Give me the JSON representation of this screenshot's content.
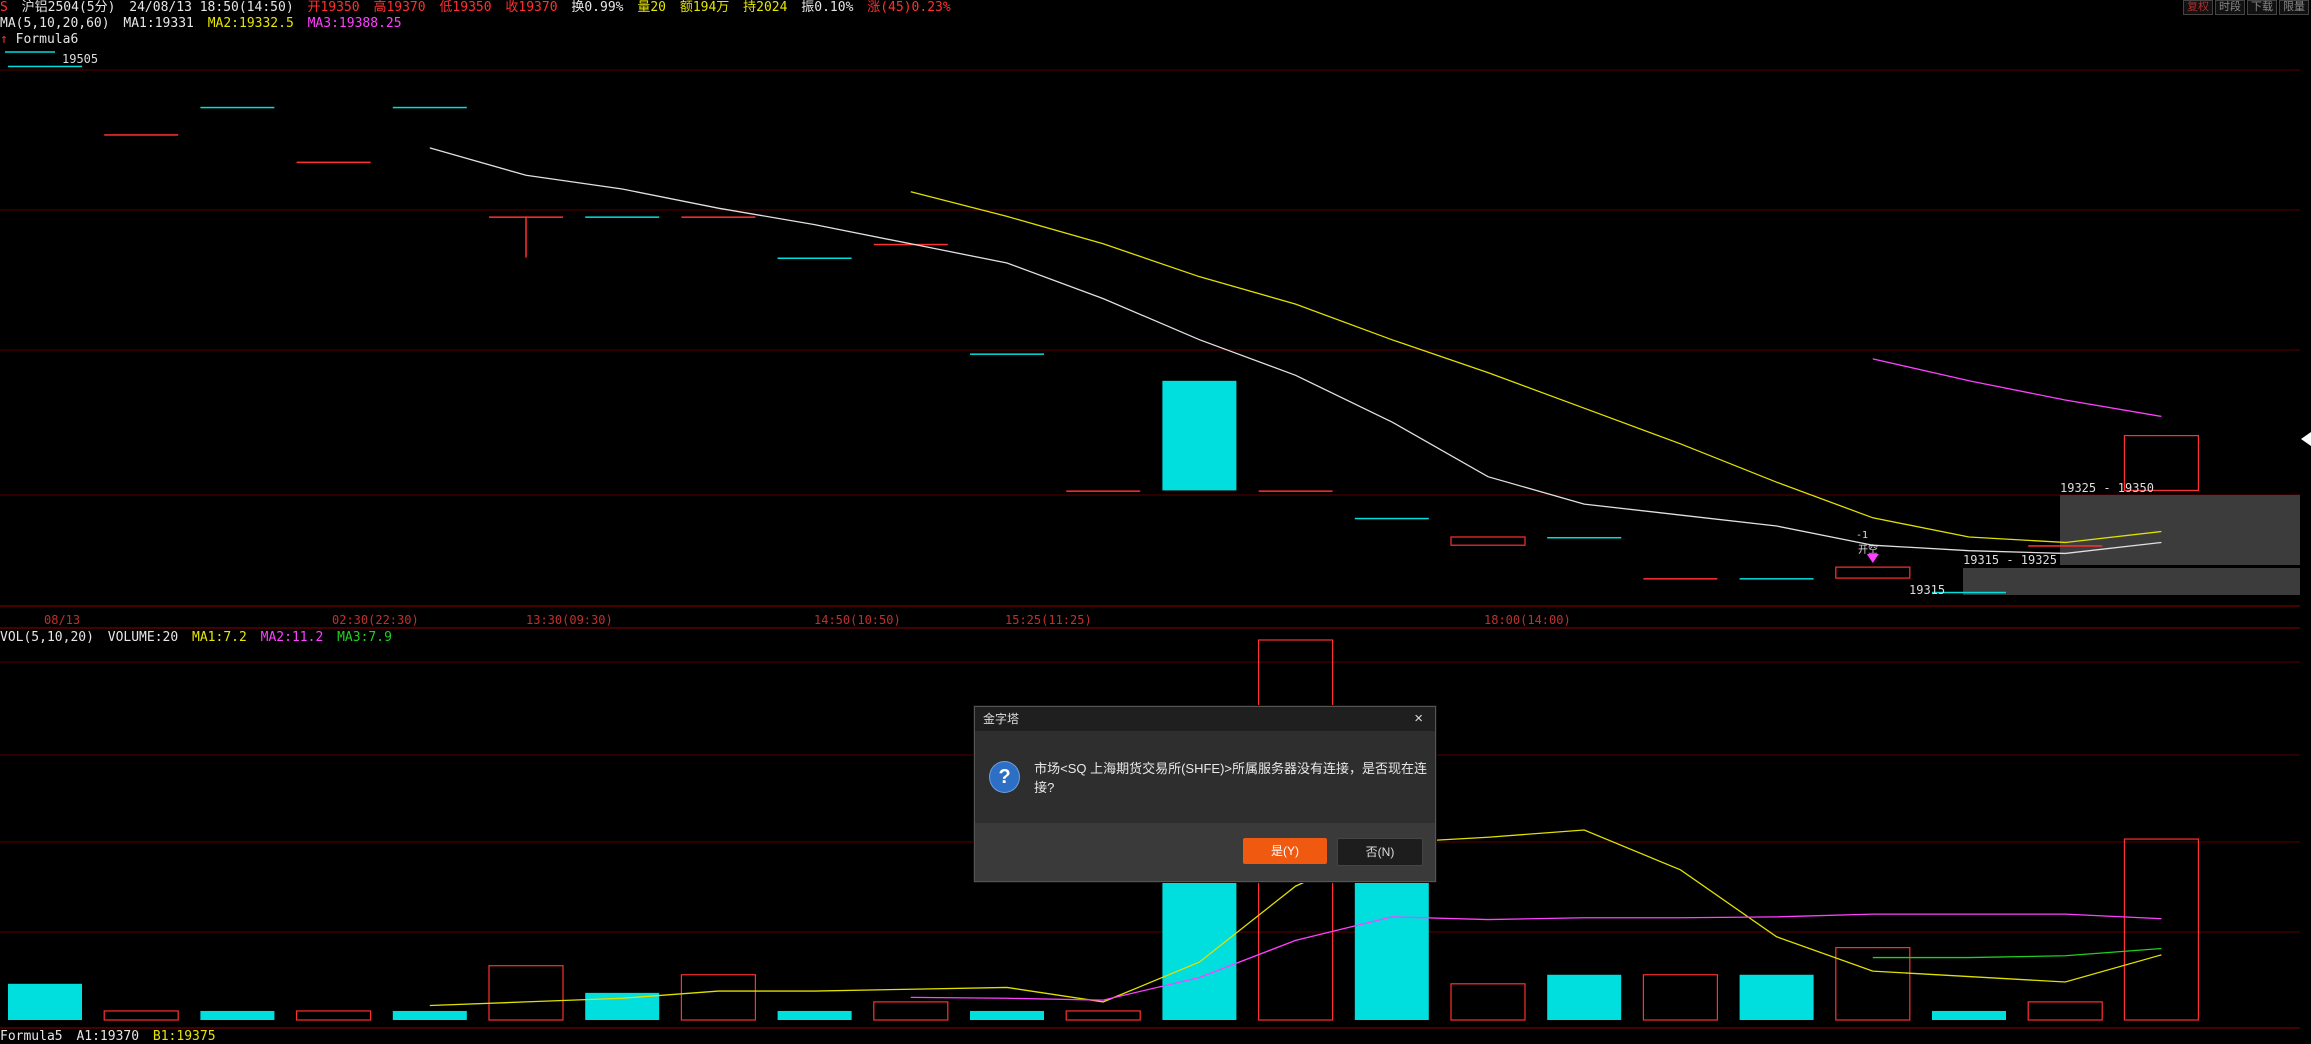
{
  "header": {
    "icon_label": "S",
    "contract": "沪铝2504(5分)",
    "datetime": "24/08/13 18:50(14:50)",
    "open": "开19350",
    "high": "高19370",
    "low": "低19350",
    "close": "收19370",
    "change_pct": "换0.99%",
    "volume": "量20",
    "amount": "额194万",
    "hold": "持2024",
    "amplitude": "振0.10%",
    "rise": "涨(45)0.23%"
  },
  "ma_line": {
    "label": "MA(5,10,20,60)",
    "ma1": "MA1:19331",
    "ma2": "MA2:19332.5",
    "ma3": "MA3:19388.25"
  },
  "formula6": {
    "label": "Formula6"
  },
  "top_buttons": [
    "复权",
    "时段",
    "下载",
    "限量"
  ],
  "price_labels": {
    "high_mark": "19505",
    "range_upper": "19325 - 19350",
    "range_lower": "19315 - 19325",
    "low_mark": "19315",
    "signal_num": "-1",
    "signal_text": "开空"
  },
  "time_axis": [
    "08/13",
    "02:30(22:30)",
    "13:30(09:30)",
    "14:50(10:50)",
    "15:25(11:25)",
    "18:00(14:00)"
  ],
  "volume_header": {
    "label": "VOL(5,10,20)",
    "volume": "VOLUME:20",
    "ma1": "MA1:7.2",
    "ma2": "MA2:11.2",
    "ma3": "MA3:7.9"
  },
  "bottom_header": {
    "label": "Formula5",
    "a1": "A1:19370",
    "b1": "B1:19375"
  },
  "dialog": {
    "title": "金字塔",
    "close_glyph": "×",
    "icon_glyph": "?",
    "message": "市场<SQ 上海期货交易所(SHFE)>所属服务器没有连接，是否现在连接?",
    "yes_label": "是(Y)",
    "no_label": "否(N)"
  },
  "colors": {
    "up": "#ff3030",
    "down": "#00dede",
    "ma1": "#e0e0e0",
    "ma2": "#e0e000",
    "ma3": "#ff40ff",
    "ma4": "#20d020",
    "grid": "#5a0000"
  },
  "chart_data": {
    "type": "candlestick",
    "price_ylim": [
      19310,
      19510
    ],
    "candles": [
      {
        "o": 19505,
        "c": 19505,
        "h": 19505,
        "l": 19505
      },
      {
        "o": 19480,
        "c": 19480,
        "h": 19480,
        "l": 19480
      },
      {
        "o": 19490,
        "c": 19490,
        "h": 19490,
        "l": 19490
      },
      {
        "o": 19470,
        "c": 19470,
        "h": 19470,
        "l": 19470
      },
      {
        "o": 19490,
        "c": 19490,
        "h": 19490,
        "l": 19490
      },
      {
        "o": 19450,
        "c": 19450,
        "h": 19450,
        "l": 19435
      },
      {
        "o": 19450,
        "c": 19450,
        "h": 19450,
        "l": 19450
      },
      {
        "o": 19450,
        "c": 19450,
        "h": 19450,
        "l": 19450
      },
      {
        "o": 19435,
        "c": 19435,
        "h": 19435,
        "l": 19435
      },
      {
        "o": 19440,
        "c": 19440,
        "h": 19440,
        "l": 19440
      },
      {
        "o": 19400,
        "c": 19400,
        "h": 19400,
        "l": 19400
      },
      {
        "o": 19350,
        "c": 19350,
        "h": 19350,
        "l": 19350
      },
      {
        "o": 19390,
        "c": 19350,
        "h": 19390,
        "l": 19350
      },
      {
        "o": 19350,
        "c": 19350,
        "h": 19350,
        "l": 19350
      },
      {
        "o": 19340,
        "c": 19340,
        "h": 19340,
        "l": 19340
      },
      {
        "o": 19330,
        "c": 19333,
        "h": 19333,
        "l": 19330
      },
      {
        "o": 19333,
        "c": 19333,
        "h": 19333,
        "l": 19333
      },
      {
        "o": 19318,
        "c": 19318,
        "h": 19318,
        "l": 19318
      },
      {
        "o": 19318,
        "c": 19318,
        "h": 19318,
        "l": 19318
      },
      {
        "o": 19318,
        "c": 19322,
        "h": 19322,
        "l": 19318
      },
      {
        "o": 19313,
        "c": 19313,
        "h": 19313,
        "l": 19313
      },
      {
        "o": 19330,
        "c": 19330,
        "h": 19330,
        "l": 19330
      },
      {
        "o": 19350,
        "c": 19370,
        "h": 19370,
        "l": 19350
      }
    ],
    "ma_white": [
      null,
      null,
      null,
      null,
      19475,
      19465,
      19460,
      19453,
      19447,
      19440,
      19433,
      19420,
      19405,
      19392,
      19375,
      19355,
      19345,
      19341,
      19337,
      19330,
      19328,
      19327,
      19331
    ],
    "ma_yellow": [
      null,
      null,
      null,
      null,
      null,
      null,
      null,
      null,
      null,
      19459,
      19450,
      19440,
      19428,
      19418,
      19405,
      19393,
      19380,
      19367,
      19353,
      19340,
      19333,
      19331,
      19335
    ],
    "ma_magenta": [
      null,
      null,
      null,
      null,
      null,
      null,
      null,
      null,
      null,
      null,
      null,
      null,
      null,
      null,
      null,
      null,
      null,
      null,
      null,
      19398,
      19390,
      19383,
      19377
    ],
    "volume_ylim": [
      0,
      42
    ],
    "volume": [
      4,
      1,
      1,
      1,
      1,
      6,
      3,
      5,
      1,
      2,
      1,
      1,
      27,
      42,
      27,
      4,
      5,
      5,
      5,
      8,
      1,
      2,
      20
    ],
    "vol_ma1": [
      null,
      null,
      null,
      null,
      1.6,
      2,
      2.4,
      3.2,
      3.2,
      3.4,
      3.6,
      2,
      6.4,
      14.8,
      19.6,
      20.2,
      21,
      16.6,
      9.2,
      5.4,
      4.8,
      4.2,
      7.2
    ],
    "vol_ma2": [
      null,
      null,
      null,
      null,
      null,
      null,
      null,
      null,
      null,
      2.5,
      2.4,
      2.2,
      4.7,
      8.8,
      11.4,
      11.1,
      11.3,
      11.3,
      11.4,
      11.7,
      11.7,
      11.7,
      11.2
    ],
    "vol_ma3": [
      null,
      null,
      null,
      null,
      null,
      null,
      null,
      null,
      null,
      null,
      null,
      null,
      null,
      null,
      null,
      null,
      null,
      null,
      null,
      6.9,
      6.9,
      7.1,
      7.9
    ]
  }
}
